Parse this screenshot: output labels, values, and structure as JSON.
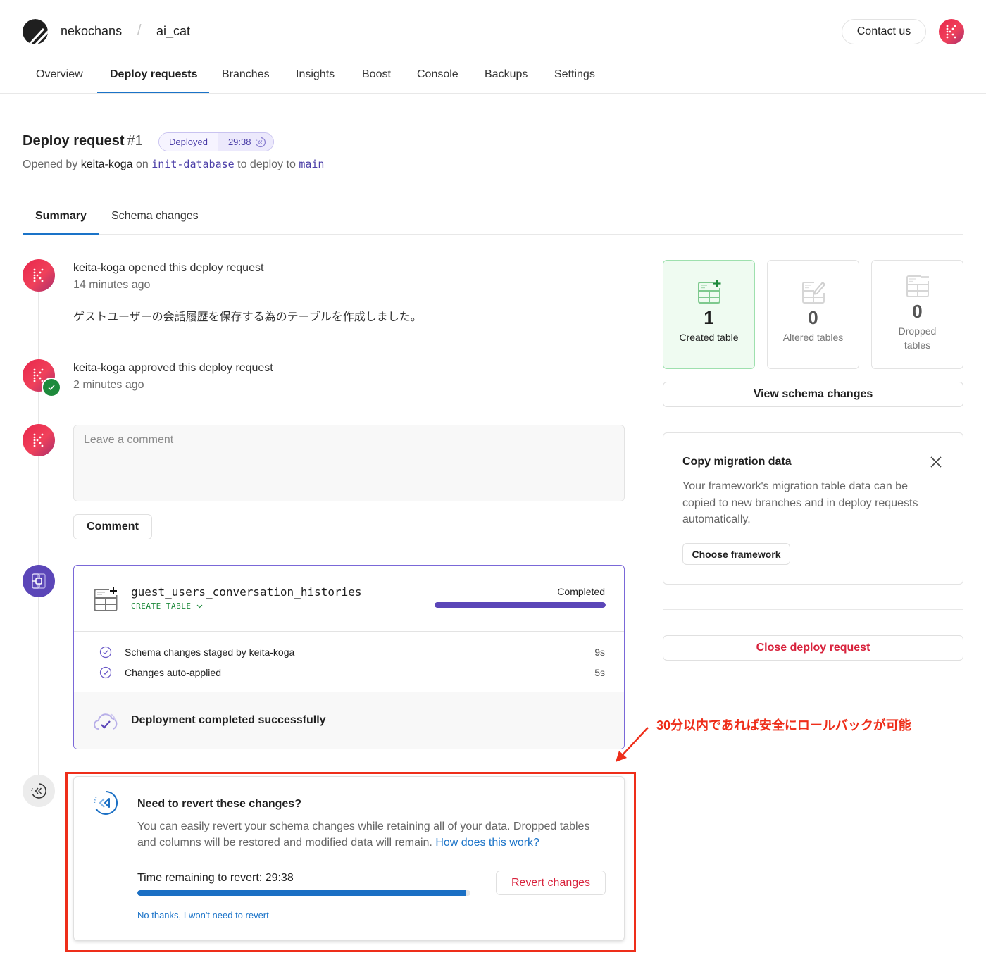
{
  "header": {
    "org": "nekochans",
    "separator": "/",
    "database": "ai_cat",
    "contact_label": "Contact us",
    "logo_icon": "planetscale-logo-icon",
    "avatar_icon": "user-avatar-icon"
  },
  "nav": {
    "items": [
      {
        "label": "Overview",
        "active": false
      },
      {
        "label": "Deploy requests",
        "active": true
      },
      {
        "label": "Branches",
        "active": false
      },
      {
        "label": "Insights",
        "active": false
      },
      {
        "label": "Boost",
        "active": false
      },
      {
        "label": "Console",
        "active": false
      },
      {
        "label": "Backups",
        "active": false
      },
      {
        "label": "Settings",
        "active": false
      }
    ]
  },
  "deploy_request": {
    "title": "Deploy request",
    "number": "#1",
    "status": "Deployed",
    "revert_timer": "29:38",
    "opened_by_prefix": "Opened by",
    "author": "keita-koga",
    "on_label": "on",
    "source_branch": "init-database",
    "deploy_to_label": "to deploy to",
    "target_branch": "main"
  },
  "tabs": [
    {
      "label": "Summary",
      "active": true
    },
    {
      "label": "Schema changes",
      "active": false
    }
  ],
  "timeline": {
    "opened": {
      "user": "keita-koga",
      "action": "opened this deploy request",
      "time": "14 minutes ago",
      "message": "ゲストユーザーの会話履歴を保存する為のテーブルを作成しました。"
    },
    "approved": {
      "user": "keita-koga",
      "action": "approved this deploy request",
      "time": "2 minutes ago"
    },
    "comment": {
      "placeholder": "Leave a comment",
      "value": "",
      "button_label": "Comment"
    },
    "deployment": {
      "table_name": "guest_users_conversation_histories",
      "operation": "CREATE TABLE",
      "status": "Completed",
      "progress_percent": 100,
      "steps": [
        {
          "label": "Schema changes staged by keita-koga",
          "duration": "9s"
        },
        {
          "label": "Changes auto-applied",
          "duration": "5s"
        }
      ],
      "result": "Deployment completed successfully"
    },
    "revert": {
      "title": "Need to revert these changes?",
      "body": "You can easily revert your schema changes while retaining all of your data. Dropped tables and columns will be restored and modified data will remain.",
      "link_label": "How does this work?",
      "time_label": "Time remaining to revert: 29:38",
      "remaining_fraction": 0.988,
      "button_label": "Revert changes",
      "dismiss_label": "No thanks, I won't need to revert"
    }
  },
  "annotation": {
    "text": "30分以内であれば安全にロールバックが可能",
    "color": "#ee2e1a"
  },
  "sidebar": {
    "stats": [
      {
        "count": "1",
        "label": "Created table",
        "highlight": true
      },
      {
        "count": "0",
        "label": "Altered tables",
        "highlight": false
      },
      {
        "count": "0",
        "label": "Dropped tables",
        "highlight": false
      }
    ],
    "view_schema_label": "View schema changes",
    "copy_migration": {
      "title": "Copy migration data",
      "body": "Your framework's migration table data can be copied to new branches and in deploy requests automatically.",
      "button_label": "Choose framework"
    },
    "close_label": "Close deploy request"
  },
  "colors": {
    "accent_blue": "#1a73c8",
    "deploy_purple": "#5b46b8",
    "danger_red": "#d8223c",
    "success_green": "#1e8a3c"
  }
}
